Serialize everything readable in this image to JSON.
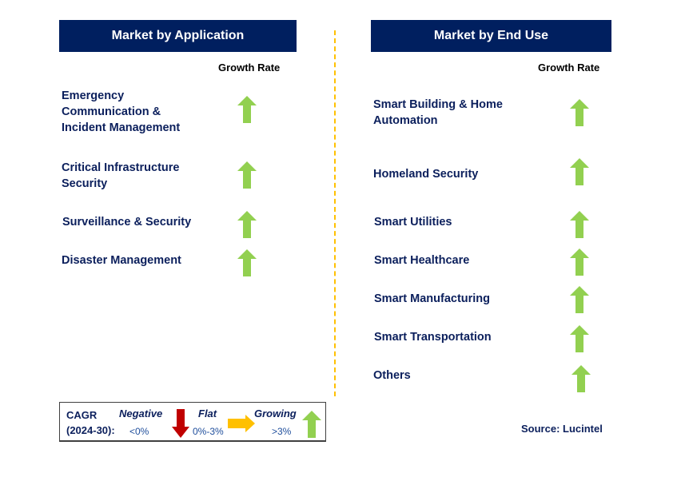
{
  "left_panel": {
    "title": "Market by Application",
    "growth_rate_label": "Growth Rate",
    "items": [
      {
        "label": "Emergency\nCommunication &\nIncident Management",
        "trend": "growing"
      },
      {
        "label": "Critical Infrastructure\nSecurity",
        "trend": "growing"
      },
      {
        "label": "Surveillance & Security",
        "trend": "growing"
      },
      {
        "label": "Disaster Management",
        "trend": "growing"
      }
    ]
  },
  "right_panel": {
    "title": "Market by End Use",
    "growth_rate_label": "Growth Rate",
    "items": [
      {
        "label": "Smart Building & Home\nAutomation",
        "trend": "growing"
      },
      {
        "label": "Homeland Security",
        "trend": "growing"
      },
      {
        "label": "Smart Utilities",
        "trend": "growing"
      },
      {
        "label": "Smart Healthcare",
        "trend": "growing"
      },
      {
        "label": "Smart Manufacturing",
        "trend": "growing"
      },
      {
        "label": "Smart Transportation",
        "trend": "growing"
      },
      {
        "label": "Others",
        "trend": "growing"
      }
    ]
  },
  "legend": {
    "cagr_label": "CAGR",
    "period_label": "(2024-30):",
    "negative": {
      "label": "Negative",
      "range": "<0%",
      "icon": "arrow-down-icon",
      "color": "#c00000"
    },
    "flat": {
      "label": "Flat",
      "range": "0%-3%",
      "icon": "arrow-right-icon",
      "color": "#ffc000"
    },
    "growing": {
      "label": "Growing",
      "range": ">3%",
      "icon": "arrow-up-icon",
      "color": "#92d050"
    }
  },
  "source": "Source: Lucintel",
  "colors": {
    "header_bg": "#001f5f",
    "text_navy": "#0b1f5c",
    "divider": "#ffc000",
    "growing_arrow": "#92d050"
  }
}
